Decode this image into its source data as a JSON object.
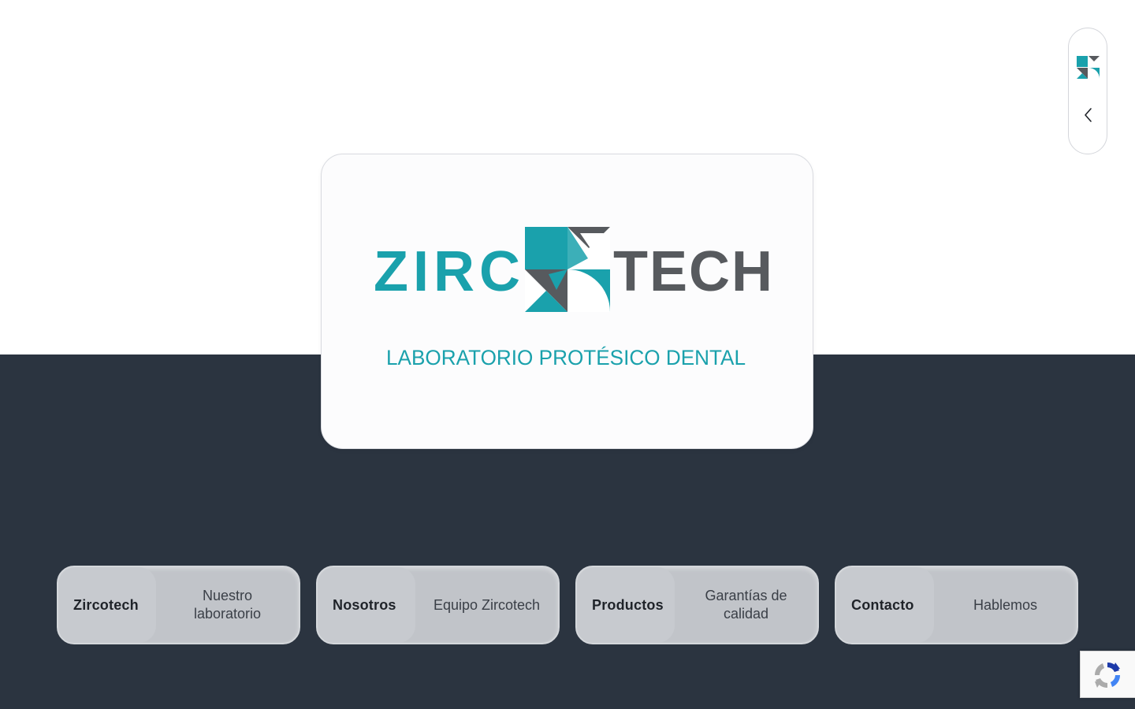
{
  "logo": {
    "wordmark_left": "ZIRC",
    "wordmark_right": "TECH",
    "tagline": "LABORATORIO PROTÉSICO DENTAL",
    "colors": {
      "teal": "#1aa1ac",
      "gray": "#575a5e"
    }
  },
  "side_rail": {
    "logo_icon": "zircotech-mini-logo-icon",
    "back_icon": "chevron-left-icon"
  },
  "nav": {
    "items": [
      {
        "title": "Zircotech",
        "subtitle": "Nuestro laboratorio"
      },
      {
        "title": "Nosotros",
        "subtitle": "Equipo Zircotech"
      },
      {
        "title": "Productos",
        "subtitle": "Garantías de calidad"
      },
      {
        "title": "Contacto",
        "subtitle": "Hablemos"
      }
    ]
  },
  "recaptcha": {
    "icon": "recaptcha-icon"
  },
  "theme": {
    "dark_band": "#2b3440",
    "card_bg": "#c1c4c9"
  }
}
